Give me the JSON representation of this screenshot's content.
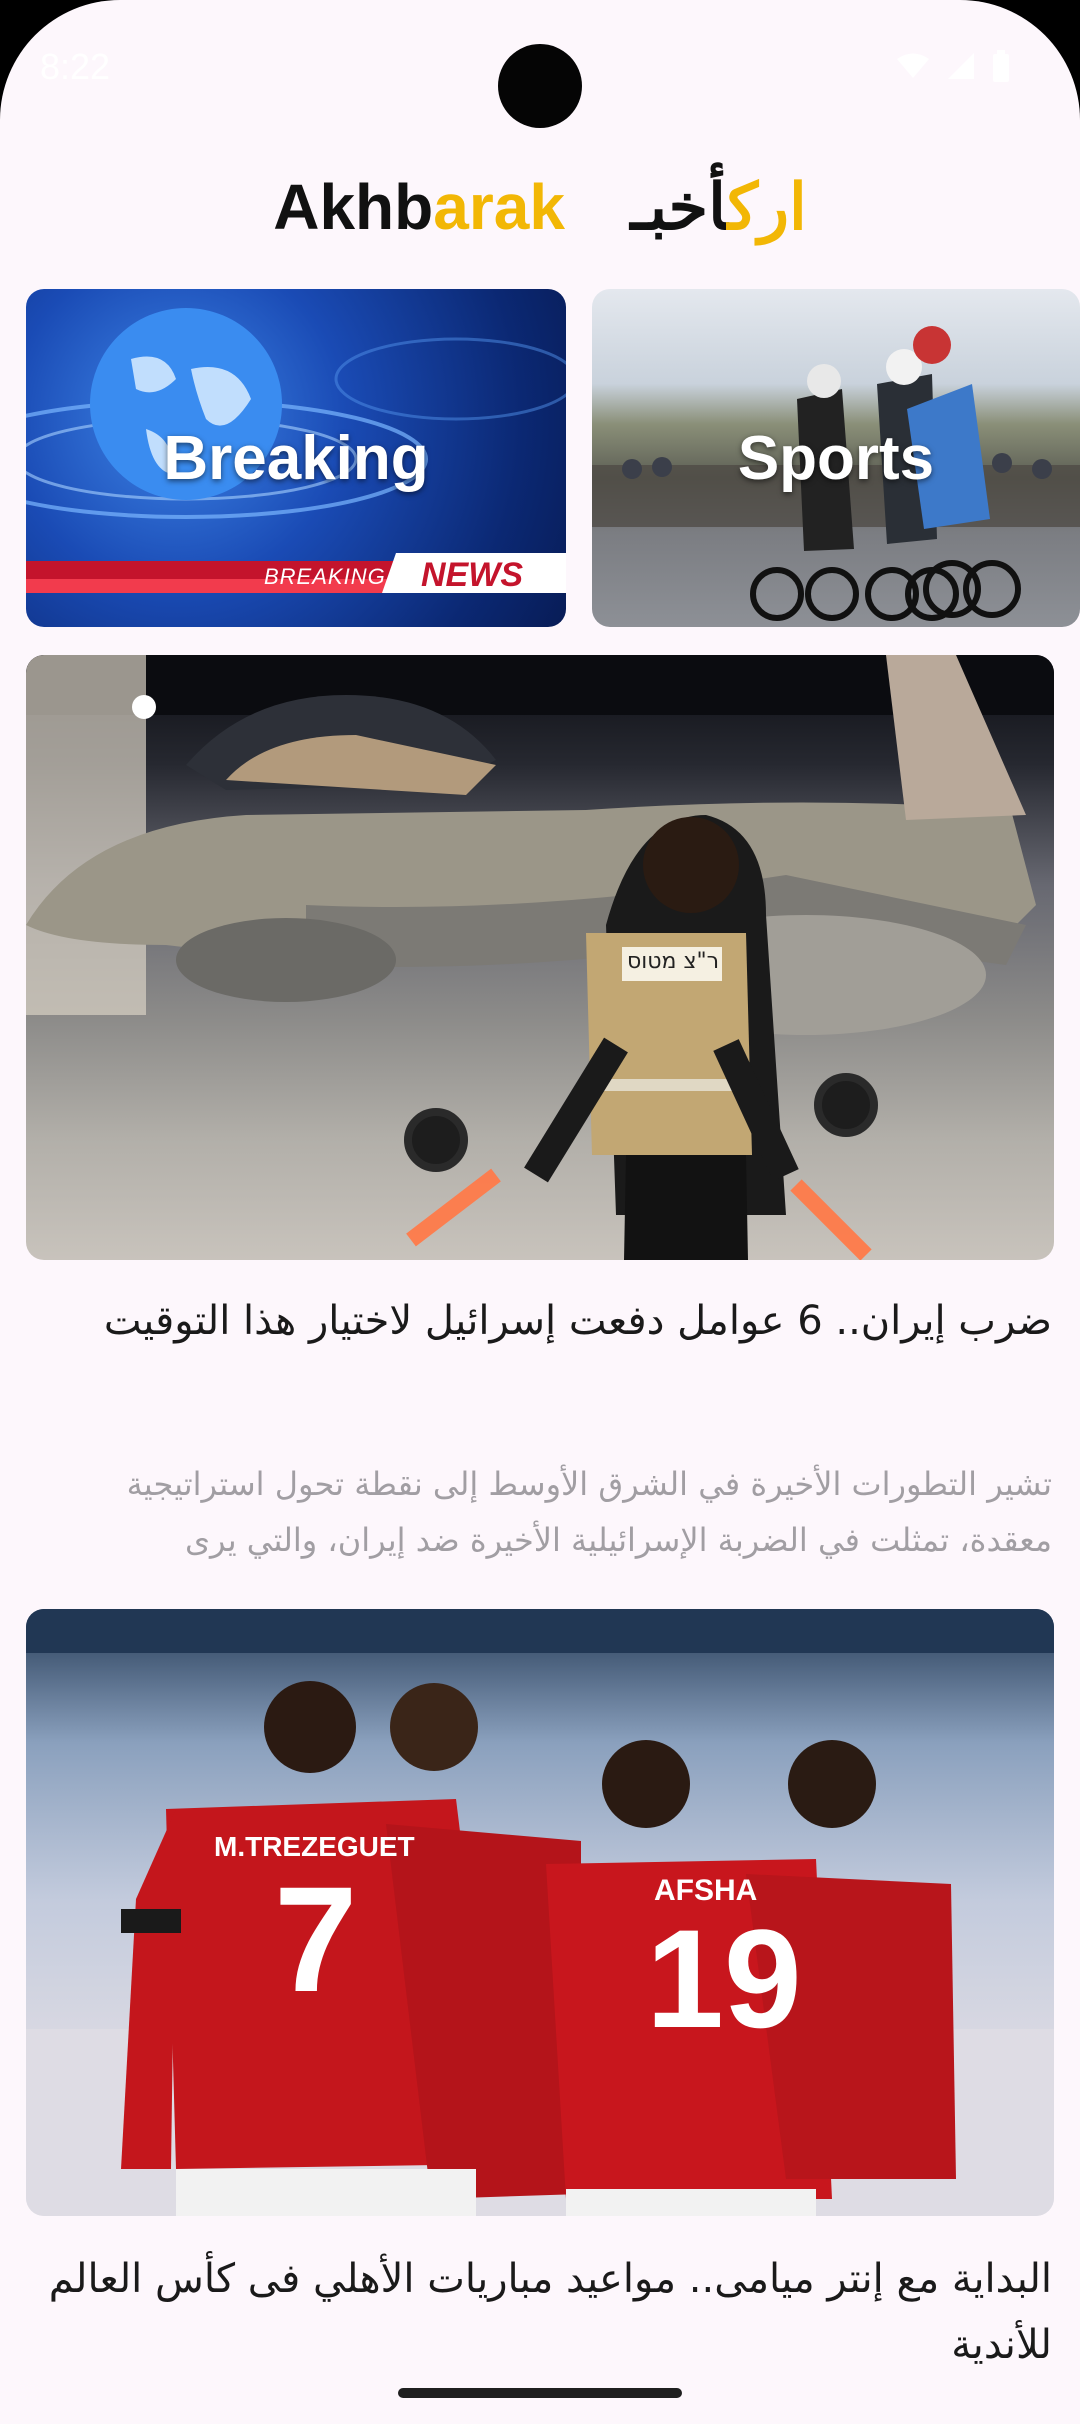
{
  "status_bar": {
    "time": "8:22"
  },
  "header": {
    "title_latin_black": "Akhb",
    "title_latin_gold": "arak",
    "title_arabic_gold": "ارك",
    "title_arabic_black": "أخبـ"
  },
  "categories": [
    {
      "label": "Breaking",
      "banner_left": "BREAKING",
      "banner_right": "NEWS"
    },
    {
      "label": "Sports"
    }
  ],
  "articles": [
    {
      "image_text": "ר\"צ מטוס",
      "headline": "ضرب إيران.. 6 عوامل دفعت إسرائيل لاختيار هذا التوقيت",
      "summary": "تشير التطورات الأخيرة في الشرق الأوسط إلى نقطة تحول استراتيجية معقدة، تمثلت في الضربة الإسرائيلية الأخيرة ضد إيران، والتي يرى"
    },
    {
      "jersey_1_name": "M.TREZEGUET",
      "jersey_1_number": "7",
      "jersey_2_name": "AFSHA",
      "jersey_2_number": "19",
      "headline": "البداية مع إنتر ميامى.. مواعيد مباريات الأهلي فى كأس العالم للأندية"
    }
  ],
  "colors": {
    "background": "#fdf7fc",
    "accent_gold": "#f2b705",
    "text_primary": "#1a1a1a",
    "text_secondary": "#a19ea3"
  }
}
